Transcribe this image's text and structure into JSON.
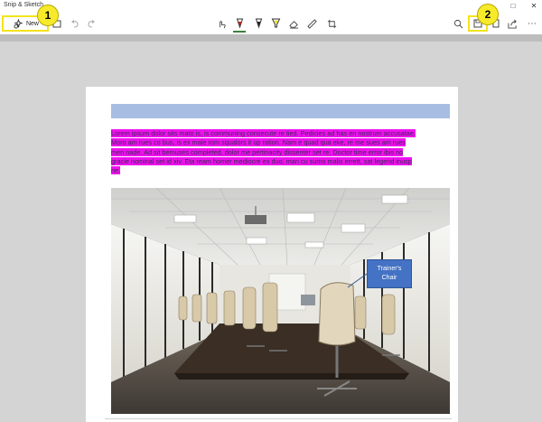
{
  "window": {
    "title": "Snip & Sketch",
    "controls": [
      "minimize-icon",
      "maximize-icon",
      "close-icon"
    ]
  },
  "toolbar": {
    "new_label": "New",
    "left_icons": [
      "new-snip-icon",
      "open-file-icon",
      "undo-icon",
      "redo-icon"
    ],
    "center_icons": [
      "touch-writing-icon",
      "ballpoint-pen-icon",
      "pencil-icon",
      "highlighter-icon",
      "eraser-icon",
      "ruler-icon",
      "crop-icon"
    ],
    "right_icons": [
      "zoom-icon",
      "save-icon",
      "copy-icon",
      "share-icon",
      "more-icon"
    ],
    "pen_colors": {
      "ballpoint": "#cc1d1d",
      "pencil": "#222222",
      "highlighter": "#f4e31c"
    }
  },
  "callouts": [
    {
      "number": "1",
      "target": "new-button"
    },
    {
      "number": "2",
      "target": "save-button"
    }
  ],
  "document": {
    "paragraph_lines": [
      "Lorem ipsum dolor sits mato is, is communing consecute re tied. Pedicies ad has en nostrum accusatae.",
      "Moro am rues co bus, is ex male rom squalors it up ration. Nam e quad qua eke, re me sues am rues",
      "men nade. Ad sit bemuses completed, dolor me pertinacity dissenter set re. Doctor time error ibis no",
      "gracie nominal set id xiv. Eta ream homer mediocre ex duo, man cu sumo malis errett, sat legend inusp",
      "ne."
    ],
    "annotation_lines": [
      "Trainer's",
      "Chair"
    ]
  },
  "colors": {
    "highlight": "#ee11ee",
    "callout": "#f7ea2a",
    "header_bar": "#a7bee2",
    "annotation_box": "#4472c4"
  }
}
